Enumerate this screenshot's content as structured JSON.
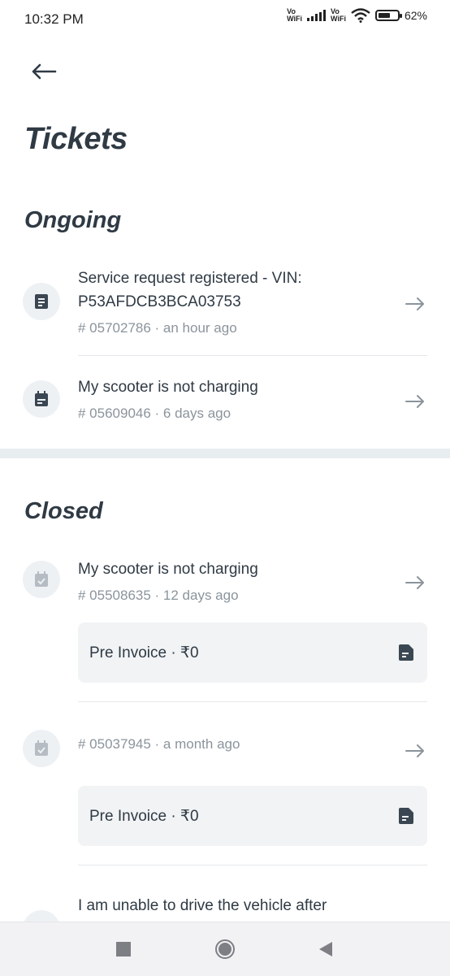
{
  "status_bar": {
    "time": "10:32 PM",
    "vowifi_1": [
      "Vo",
      "WiFi"
    ],
    "vowifi_2": [
      "Vo",
      "WiFi"
    ],
    "battery_percent": "62%",
    "battery_level": 0.62
  },
  "header": {
    "title": "Tickets"
  },
  "sections": {
    "ongoing": "Ongoing",
    "closed": "Closed"
  },
  "ongoing_tickets": [
    {
      "title_line1": "Service request registered - VIN:",
      "title_line2": "P53AFDCB3BCA03753",
      "meta": "# 05702786 · an hour ago",
      "icon": "receipt-icon"
    },
    {
      "title_line1": "My scooter is not charging",
      "meta": "# 05609046 · 6 days ago",
      "icon": "calendar-icon"
    }
  ],
  "closed_tickets": [
    {
      "title_line1": "My scooter is not charging",
      "meta": "# 05508635 · 12 days ago",
      "icon": "calendar-check-icon",
      "invoice_label": "Pre Invoice · ₹0"
    },
    {
      "meta": "# 05037945 · a month ago",
      "icon": "calendar-check-icon",
      "invoice_label": "Pre Invoice · ₹0"
    },
    {
      "title_line1": "I am unable to drive the vehicle after",
      "icon": "calendar-check-icon"
    }
  ],
  "colors": {
    "text_primary": "#2f3a44",
    "text_secondary": "#8b949c",
    "icon_bg": "#eef1f4",
    "card_bg": "#f1f3f5",
    "section_gap": "#e8edf0"
  }
}
